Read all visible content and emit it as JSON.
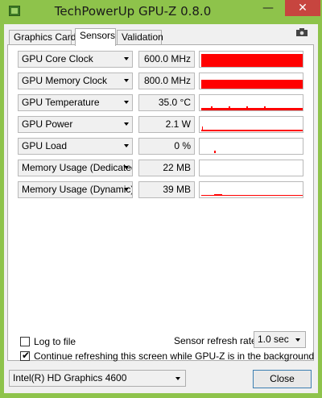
{
  "window": {
    "title": "TechPowerUp GPU-Z 0.8.0",
    "minimize_glyph": "—",
    "close_glyph": "✕"
  },
  "tabs": [
    {
      "label": "Graphics Card",
      "active": false
    },
    {
      "label": "Sensors",
      "active": true
    },
    {
      "label": "Validation",
      "active": false
    }
  ],
  "sensors": [
    {
      "name": "GPU Core Clock",
      "value": "600.0 MHz",
      "load_fraction": 0.75
    },
    {
      "name": "GPU Memory Clock",
      "value": "800.0 MHz",
      "load_fraction": 0.45
    },
    {
      "name": "GPU Temperature",
      "value": "35.0 °C",
      "load_fraction": 0.1
    },
    {
      "name": "GPU Power",
      "value": "2.1 W",
      "load_fraction": 0.05
    },
    {
      "name": "GPU Load",
      "value": "0 %",
      "load_fraction": 0.0
    },
    {
      "name": "Memory Usage (Dedicated)",
      "value": "22 MB",
      "load_fraction": 0.0
    },
    {
      "name": "Memory Usage (Dynamic)",
      "value": "39 MB",
      "load_fraction": 0.03
    }
  ],
  "options": {
    "log_to_file_label": "Log to file",
    "log_to_file_checked": false,
    "continue_label": "Continue refreshing this screen while GPU-Z is in the background",
    "continue_checked": true,
    "refresh_rate_label": "Sensor refresh rate:",
    "refresh_rate_value": "1.0 sec"
  },
  "footer": {
    "gpu_select_value": "Intel(R) HD Graphics 4600",
    "close_label": "Close"
  },
  "colors": {
    "graph": "#ff0000",
    "window_frame": "#8ec34b"
  }
}
